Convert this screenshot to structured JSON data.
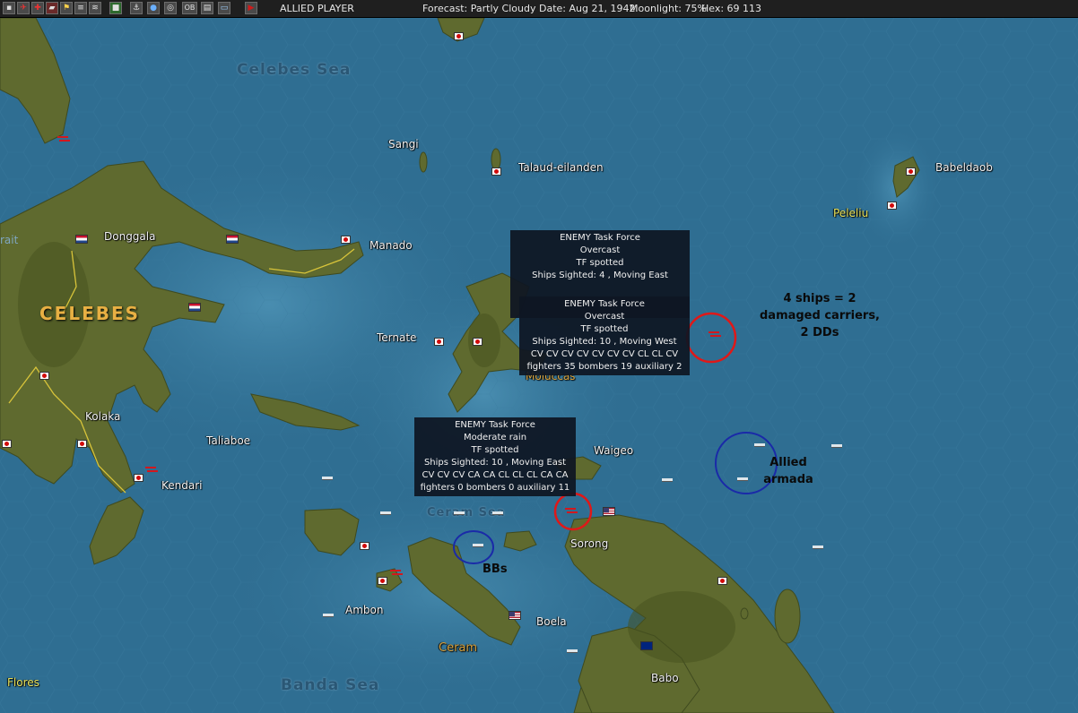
{
  "header": {
    "player": "ALLIED PLAYER",
    "forecast": "Forecast: Partly Cloudy",
    "date": "Date: Aug 21, 1942",
    "moonlight": "Moonlight: 75%",
    "hex": "Hex: 69 113",
    "toolbar_icons": [
      "menu-icon",
      "air-icon",
      "cross-icon",
      "flag-icon",
      "boat-icon",
      "ships-icon",
      "base-icon",
      "sub-icon",
      "globe-icon",
      "target-icon",
      "ob-icon",
      "report-icon",
      "info-icon",
      "play-icon"
    ],
    "ob_label": "OB",
    "play_color": "#d11a1a"
  },
  "map": {
    "sea_labels": [
      "Celebes Sea",
      "Banda Sea",
      "Ceram Sea",
      "Molucca"
    ],
    "places": {
      "sangi": "Sangi",
      "talaud": "Talaud-eilanden",
      "babeldaob": "Babeldaob",
      "peleliu": "Peleliu",
      "donggala": "Donggala",
      "manado": "Manado",
      "celebes": "CELEBES",
      "ternate": "Ternate",
      "moluccas": "Moluccas",
      "kolaka": "Kolaka",
      "taliaboe": "Taliaboe",
      "kendari": "Kendari",
      "waigeo": "Waigeo",
      "sorong": "Sorong",
      "ambon": "Ambon",
      "boela": "Boela",
      "ceram": "Ceram",
      "babo": "Babo",
      "flores": "Flores",
      "edge_left": "rait"
    },
    "colors": {
      "sea": "#2f6e92",
      "land": "#5e6b2e",
      "red_circle": "#e01818",
      "blue_circle": "#1a2aa8"
    }
  },
  "popups": [
    {
      "title": "ENEMY Task Force",
      "weather": "Overcast",
      "spotted": "TF spotted",
      "ships": "Ships Sighted: 4 , Moving East"
    },
    {
      "title": "ENEMY Task Force",
      "weather": "Overcast",
      "spotted": "TF spotted",
      "ships": "Ships Sighted: 10 , Moving West",
      "composition": "CV CV CV CV CV CV CV CL CL CV",
      "aircraft": "fighters 35  bombers 19  auxiliary 2"
    },
    {
      "title": "ENEMY Task Force",
      "weather": "Moderate rain",
      "spotted": "TF spotted",
      "ships": "Ships Sighted: 10 , Moving East",
      "composition": "CV CV CV CA CA CL CL CL CA CA",
      "aircraft": "fighters 0  bombers 0  auxiliary 11"
    }
  ],
  "annotations": {
    "carriers": [
      "4 ships = 2",
      "damaged carriers,",
      "2 DDs"
    ],
    "armada": [
      "Allied",
      "armada"
    ],
    "bbs": "BBs"
  }
}
